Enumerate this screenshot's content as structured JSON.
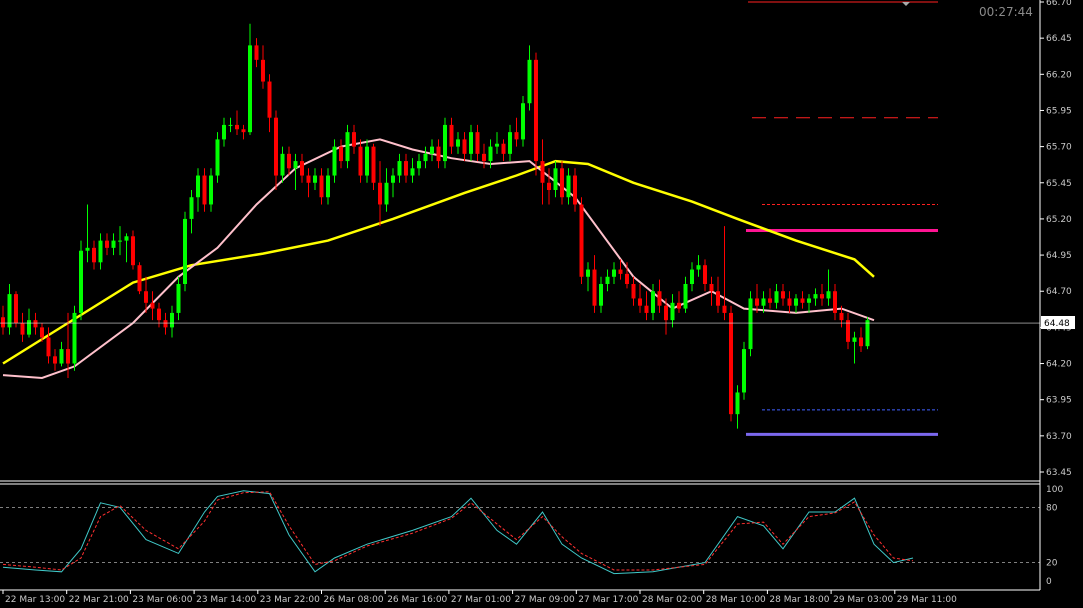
{
  "timer": "00:27:44",
  "chart_data": [
    {
      "type": "candlestick",
      "colors": {
        "background": "#000000",
        "bull": "#00ff00",
        "bear": "#ff0000",
        "ma_fast": "#ffc0cb",
        "ma_slow": "#ffff00",
        "level_magenta": "#ff1493",
        "level_purple": "#7b68ee",
        "level_red_dashed": "#ff2020",
        "level_blue_dashed": "#4060ff",
        "price_line": "#e0e0e0",
        "axis": "#ffffff"
      },
      "y_ticks": [
        "66.70",
        "66.45",
        "66.20",
        "65.95",
        "65.70",
        "65.45",
        "65.20",
        "64.95",
        "64.70",
        "64.45",
        "64.20",
        "63.95",
        "63.70",
        "63.45"
      ],
      "ylim": [
        63.39,
        66.7
      ],
      "current_price": "64.48",
      "current_price_value": 64.48,
      "x_ticks": [
        "22 Mar 13:00",
        "22 Mar 21:00",
        "23 Mar 06:00",
        "23 Mar 14:00",
        "23 Mar 22:00",
        "26 Mar 08:00",
        "26 Mar 16:00",
        "27 Mar 01:00",
        "27 Mar 09:00",
        "27 Mar 17:00",
        "28 Mar 02:00",
        "28 Mar 10:00",
        "28 Mar 18:00",
        "29 Mar 03:00",
        "29 Mar 11:00"
      ],
      "levels": [
        {
          "price": 66.7,
          "style": "solid",
          "color": "level_red_dashed"
        },
        {
          "price": 65.9,
          "style": "dashed",
          "color": "level_red_dashed"
        },
        {
          "price": 65.3,
          "style": "dotted",
          "color": "level_red_dashed"
        },
        {
          "price": 65.12,
          "style": "thick",
          "color": "level_magenta"
        },
        {
          "price": 63.88,
          "style": "dotted",
          "color": "level_blue_dashed"
        },
        {
          "price": 63.71,
          "style": "thick",
          "color": "level_purple"
        }
      ],
      "candles": [
        [
          64.52,
          64.6,
          64.4,
          64.45
        ],
        [
          64.45,
          64.75,
          64.4,
          64.68
        ],
        [
          64.68,
          64.7,
          64.45,
          64.48
        ],
        [
          64.48,
          64.55,
          64.35,
          64.4
        ],
        [
          64.4,
          64.58,
          64.38,
          64.5
        ],
        [
          64.5,
          64.55,
          64.4,
          64.45
        ],
        [
          64.45,
          64.48,
          64.35,
          64.38
        ],
        [
          64.38,
          64.45,
          64.2,
          64.25
        ],
        [
          64.25,
          64.3,
          64.15,
          64.2
        ],
        [
          64.2,
          64.35,
          64.18,
          64.3
        ],
        [
          64.3,
          64.55,
          64.1,
          64.2
        ],
        [
          64.2,
          64.6,
          64.15,
          64.55
        ],
        [
          64.55,
          65.05,
          64.5,
          64.98
        ],
        [
          64.98,
          65.3,
          64.9,
          65.0
        ],
        [
          65.0,
          65.05,
          64.85,
          64.9
        ],
        [
          64.9,
          65.1,
          64.85,
          65.05
        ],
        [
          65.05,
          65.1,
          64.95,
          65.0
        ],
        [
          65.0,
          65.1,
          64.95,
          65.05
        ],
        [
          65.05,
          65.15,
          64.95,
          65.05
        ],
        [
          65.05,
          65.1,
          64.9,
          65.08
        ],
        [
          65.08,
          65.12,
          64.85,
          64.88
        ],
        [
          64.88,
          64.9,
          64.68,
          64.7
        ],
        [
          64.7,
          64.8,
          64.55,
          64.62
        ],
        [
          64.62,
          64.7,
          64.5,
          64.58
        ],
        [
          64.58,
          64.62,
          64.45,
          64.5
        ],
        [
          64.5,
          64.55,
          64.4,
          64.45
        ],
        [
          64.45,
          64.6,
          64.38,
          64.55
        ],
        [
          64.55,
          64.8,
          64.5,
          64.75
        ],
        [
          64.75,
          65.25,
          64.7,
          65.2
        ],
        [
          65.2,
          65.4,
          65.1,
          65.35
        ],
        [
          65.35,
          65.55,
          65.25,
          65.5
        ],
        [
          65.5,
          65.55,
          65.25,
          65.3
        ],
        [
          65.3,
          65.55,
          65.25,
          65.5
        ],
        [
          65.5,
          65.8,
          65.45,
          65.75
        ],
        [
          65.75,
          65.9,
          65.7,
          65.85
        ],
        [
          65.85,
          65.9,
          65.8,
          65.85
        ],
        [
          65.85,
          65.95,
          65.78,
          65.82
        ],
        [
          65.82,
          65.85,
          65.75,
          65.8
        ],
        [
          65.8,
          66.55,
          65.78,
          66.4
        ],
        [
          66.4,
          66.45,
          66.25,
          66.3
        ],
        [
          66.3,
          66.4,
          66.1,
          66.15
        ],
        [
          66.15,
          66.2,
          65.8,
          65.9
        ],
        [
          65.9,
          65.95,
          65.4,
          65.5
        ],
        [
          65.5,
          65.7,
          65.45,
          65.65
        ],
        [
          65.65,
          65.7,
          65.5,
          65.55
        ],
        [
          65.55,
          65.65,
          65.4,
          65.6
        ],
        [
          65.6,
          65.65,
          65.45,
          65.5
        ],
        [
          65.5,
          65.55,
          65.35,
          65.45
        ],
        [
          65.45,
          65.55,
          65.4,
          65.5
        ],
        [
          65.5,
          65.55,
          65.3,
          65.35
        ],
        [
          65.35,
          65.55,
          65.3,
          65.5
        ],
        [
          65.5,
          65.75,
          65.45,
          65.7
        ],
        [
          65.7,
          65.75,
          65.55,
          65.6
        ],
        [
          65.6,
          65.85,
          65.55,
          65.8
        ],
        [
          65.8,
          65.85,
          65.65,
          65.7
        ],
        [
          65.7,
          65.75,
          65.45,
          65.5
        ],
        [
          65.5,
          65.75,
          65.45,
          65.7
        ],
        [
          65.7,
          65.72,
          65.4,
          65.45
        ],
        [
          65.45,
          65.6,
          65.15,
          65.3
        ],
        [
          65.3,
          65.55,
          65.25,
          65.45
        ],
        [
          65.45,
          65.55,
          65.35,
          65.5
        ],
        [
          65.5,
          65.65,
          65.45,
          65.6
        ],
        [
          65.6,
          65.65,
          65.45,
          65.5
        ],
        [
          65.5,
          65.62,
          65.45,
          65.55
        ],
        [
          65.55,
          65.65,
          65.5,
          65.6
        ],
        [
          65.6,
          65.7,
          65.55,
          65.65
        ],
        [
          65.65,
          65.75,
          65.6,
          65.7
        ],
        [
          65.7,
          65.75,
          65.55,
          65.6
        ],
        [
          65.6,
          65.9,
          65.55,
          65.85
        ],
        [
          65.85,
          65.9,
          65.65,
          65.7
        ],
        [
          65.7,
          65.8,
          65.65,
          65.75
        ],
        [
          65.75,
          65.8,
          65.6,
          65.65
        ],
        [
          65.65,
          65.85,
          65.6,
          65.8
        ],
        [
          65.8,
          65.85,
          65.6,
          65.65
        ],
        [
          65.65,
          65.72,
          65.55,
          65.6
        ],
        [
          65.6,
          65.75,
          65.55,
          65.7
        ],
        [
          65.7,
          65.8,
          65.65,
          65.72
        ],
        [
          65.72,
          65.75,
          65.6,
          65.65
        ],
        [
          65.65,
          65.85,
          65.6,
          65.8
        ],
        [
          65.8,
          65.9,
          65.7,
          65.75
        ],
        [
          65.75,
          66.05,
          65.7,
          66.0
        ],
        [
          66.0,
          66.4,
          65.95,
          66.3
        ],
        [
          66.3,
          66.35,
          65.5,
          65.6
        ],
        [
          65.6,
          65.75,
          65.3,
          65.45
        ],
        [
          65.45,
          65.55,
          65.3,
          65.4
        ],
        [
          65.4,
          65.6,
          65.35,
          65.55
        ],
        [
          65.55,
          65.6,
          65.3,
          65.35
        ],
        [
          65.35,
          65.55,
          65.3,
          65.5
        ],
        [
          65.5,
          65.55,
          65.25,
          65.3
        ],
        [
          65.3,
          65.35,
          64.75,
          64.8
        ],
        [
          64.8,
          64.9,
          64.7,
          64.85
        ],
        [
          64.85,
          64.95,
          64.55,
          64.6
        ],
        [
          64.6,
          64.8,
          64.55,
          64.75
        ],
        [
          64.75,
          64.85,
          64.7,
          64.8
        ],
        [
          64.8,
          64.9,
          64.75,
          64.85
        ],
        [
          64.85,
          64.92,
          64.78,
          64.82
        ],
        [
          64.82,
          64.9,
          64.72,
          64.75
        ],
        [
          64.75,
          64.8,
          64.6,
          64.65
        ],
        [
          64.65,
          64.75,
          64.55,
          64.6
        ],
        [
          64.6,
          64.7,
          64.5,
          64.55
        ],
        [
          64.55,
          64.75,
          64.5,
          64.7
        ],
        [
          64.7,
          64.78,
          64.55,
          64.6
        ],
        [
          64.6,
          64.65,
          64.4,
          64.5
        ],
        [
          64.5,
          64.68,
          64.45,
          64.62
        ],
        [
          64.62,
          64.7,
          64.55,
          64.58
        ],
        [
          64.58,
          64.8,
          64.55,
          64.75
        ],
        [
          64.75,
          64.9,
          64.7,
          64.85
        ],
        [
          64.85,
          64.95,
          64.8,
          64.88
        ],
        [
          64.88,
          64.92,
          64.7,
          64.75
        ],
        [
          64.75,
          64.8,
          64.6,
          64.7
        ],
        [
          64.7,
          64.8,
          64.55,
          64.6
        ],
        [
          64.6,
          65.15,
          64.5,
          64.55
        ],
        [
          64.55,
          64.6,
          63.8,
          63.85
        ],
        [
          63.85,
          64.05,
          63.75,
          64.0
        ],
        [
          64.0,
          64.35,
          63.95,
          64.3
        ],
        [
          64.3,
          64.7,
          64.25,
          64.65
        ],
        [
          64.65,
          64.75,
          64.55,
          64.6
        ],
        [
          64.6,
          64.7,
          64.55,
          64.65
        ],
        [
          64.65,
          64.72,
          64.58,
          64.62
        ],
        [
          64.62,
          64.75,
          64.58,
          64.7
        ],
        [
          64.7,
          64.75,
          64.6,
          64.65
        ],
        [
          64.65,
          64.7,
          64.55,
          64.6
        ],
        [
          64.6,
          64.68,
          64.55,
          64.65
        ],
        [
          64.65,
          64.7,
          64.58,
          64.62
        ],
        [
          64.62,
          64.68,
          64.55,
          64.65
        ],
        [
          64.65,
          64.72,
          64.6,
          64.68
        ],
        [
          64.68,
          64.75,
          64.6,
          64.65
        ],
        [
          64.65,
          64.85,
          64.6,
          64.7
        ],
        [
          64.7,
          64.75,
          64.5,
          64.55
        ],
        [
          64.55,
          64.6,
          64.45,
          64.5
        ],
        [
          64.5,
          64.55,
          64.3,
          64.35
        ],
        [
          64.35,
          64.42,
          64.2,
          64.38
        ],
        [
          64.38,
          64.45,
          64.28,
          64.32
        ],
        [
          64.32,
          64.52,
          64.3,
          64.5
        ]
      ],
      "ma_fast": [
        [
          0,
          64.12
        ],
        [
          6,
          64.1
        ],
        [
          11,
          64.18
        ],
        [
          20,
          64.48
        ],
        [
          27,
          64.8
        ],
        [
          33,
          65.0
        ],
        [
          39,
          65.3
        ],
        [
          45,
          65.55
        ],
        [
          52,
          65.7
        ],
        [
          58,
          65.75
        ],
        [
          63,
          65.68
        ],
        [
          69,
          65.62
        ],
        [
          75,
          65.58
        ],
        [
          81,
          65.6
        ],
        [
          88,
          65.35
        ],
        [
          97,
          64.8
        ],
        [
          103,
          64.58
        ],
        [
          109,
          64.7
        ],
        [
          114,
          64.58
        ],
        [
          122,
          64.55
        ],
        [
          129,
          64.58
        ],
        [
          134,
          64.5
        ]
      ],
      "ma_slow": [
        [
          0,
          64.2
        ],
        [
          10,
          64.48
        ],
        [
          20,
          64.76
        ],
        [
          29,
          64.88
        ],
        [
          40,
          64.96
        ],
        [
          50,
          65.05
        ],
        [
          60,
          65.2
        ],
        [
          71,
          65.38
        ],
        [
          79,
          65.5
        ],
        [
          85,
          65.6
        ],
        [
          90,
          65.58
        ],
        [
          97,
          65.45
        ],
        [
          106,
          65.32
        ],
        [
          113,
          65.2
        ],
        [
          122,
          65.05
        ],
        [
          131,
          64.92
        ],
        [
          134,
          64.8
        ]
      ],
      "indicator": {
        "type": "line",
        "y_ticks": [
          "100",
          "80",
          "20",
          "0"
        ],
        "ylim": [
          0,
          100
        ],
        "levels": [
          80,
          20
        ],
        "main_color": "#40c8c8",
        "signal_color": "#ff3030",
        "main": [
          [
            0,
            15
          ],
          [
            5,
            12
          ],
          [
            9,
            10
          ],
          [
            12,
            35
          ],
          [
            15,
            85
          ],
          [
            18,
            80
          ],
          [
            22,
            45
          ],
          [
            27,
            30
          ],
          [
            31,
            75
          ],
          [
            33,
            92
          ],
          [
            37,
            98
          ],
          [
            41,
            95
          ],
          [
            44,
            50
          ],
          [
            48,
            10
          ],
          [
            51,
            25
          ],
          [
            56,
            40
          ],
          [
            63,
            55
          ],
          [
            69,
            70
          ],
          [
            72,
            90
          ],
          [
            76,
            55
          ],
          [
            79,
            40
          ],
          [
            83,
            75
          ],
          [
            86,
            40
          ],
          [
            89,
            25
          ],
          [
            94,
            8
          ],
          [
            100,
            10
          ],
          [
            108,
            20
          ],
          [
            113,
            70
          ],
          [
            117,
            60
          ],
          [
            120,
            35
          ],
          [
            124,
            75
          ],
          [
            128,
            75
          ],
          [
            131,
            90
          ],
          [
            134,
            40
          ],
          [
            137,
            20
          ],
          [
            140,
            25
          ]
        ],
        "signal": [
          [
            0,
            18
          ],
          [
            5,
            15
          ],
          [
            9,
            12
          ],
          [
            12,
            25
          ],
          [
            15,
            70
          ],
          [
            18,
            82
          ],
          [
            22,
            55
          ],
          [
            27,
            35
          ],
          [
            31,
            65
          ],
          [
            33,
            88
          ],
          [
            37,
            96
          ],
          [
            41,
            97
          ],
          [
            44,
            60
          ],
          [
            48,
            18
          ],
          [
            51,
            22
          ],
          [
            56,
            38
          ],
          [
            63,
            52
          ],
          [
            69,
            68
          ],
          [
            72,
            85
          ],
          [
            76,
            62
          ],
          [
            79,
            45
          ],
          [
            83,
            70
          ],
          [
            86,
            48
          ],
          [
            89,
            30
          ],
          [
            94,
            12
          ],
          [
            100,
            12
          ],
          [
            108,
            18
          ],
          [
            113,
            62
          ],
          [
            117,
            64
          ],
          [
            120,
            40
          ],
          [
            124,
            70
          ],
          [
            128,
            74
          ],
          [
            131,
            86
          ],
          [
            134,
            50
          ],
          [
            137,
            25
          ],
          [
            140,
            22
          ]
        ]
      }
    }
  ]
}
